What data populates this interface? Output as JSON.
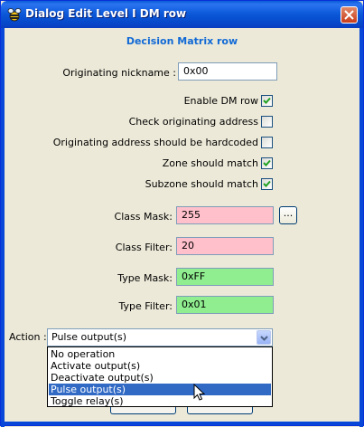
{
  "window": {
    "title": "Dialog Edit Level I DM row"
  },
  "heading": "Decision Matrix row",
  "fields": {
    "originating_nickname": {
      "label": "Originating nickname :",
      "value": "0x00"
    },
    "class_mask": {
      "label": "Class Mask:",
      "value": "255"
    },
    "class_filter": {
      "label": "Class Filter:",
      "value": "20"
    },
    "type_mask": {
      "label": "Type Mask:",
      "value": "0xFF"
    },
    "type_filter": {
      "label": "Type Filter:",
      "value": "0x01"
    }
  },
  "checkboxes": {
    "enable_dm_row": {
      "label": "Enable DM row",
      "checked": true
    },
    "check_originating_address": {
      "label": "Check originating address",
      "checked": false
    },
    "hardcoded_address": {
      "label": "Originating address should be hardcoded",
      "checked": false
    },
    "zone_match": {
      "label": "Zone should match",
      "checked": true
    },
    "subzone_match": {
      "label": "Subzone should match",
      "checked": true
    }
  },
  "class_mask_button": "...",
  "action": {
    "label": "Action :",
    "selected": "Pulse output(s)",
    "options": [
      "No operation",
      "Activate output(s)",
      "Deactivate output(s)",
      "Pulse output(s)",
      "Toggle relay(s)"
    ],
    "highlighted_index": 3
  },
  "colors": {
    "mask_field_bg": "#ffc0cb",
    "type_field_bg": "#90ee90",
    "heading": "#1169d6",
    "selection": "#316ac5"
  },
  "icons": {
    "app": "bee-icon",
    "close": "close-icon",
    "dropdown": "chevron-down-icon",
    "check": "checkmark-icon",
    "pointer": "mouse-pointer-icon"
  }
}
